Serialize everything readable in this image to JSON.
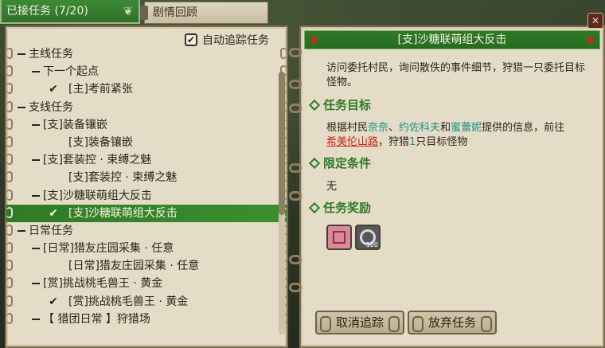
{
  "tabs": {
    "accepted": "已接任务 (7/20)",
    "story": "剧情回顾"
  },
  "auto_track_label": "自动追踪任务",
  "quest_list": [
    {
      "level": 0,
      "type": "dash",
      "text": "主线任务",
      "selected": false
    },
    {
      "level": 1,
      "type": "dash",
      "text": "下一个起点",
      "selected": false
    },
    {
      "level": 2,
      "type": "check",
      "text": "[主]考前紧张",
      "selected": false
    },
    {
      "level": 0,
      "type": "dash",
      "text": "支线任务",
      "selected": false
    },
    {
      "level": 1,
      "type": "dash",
      "text": "[支]装备镶嵌",
      "selected": false
    },
    {
      "level": 2,
      "type": "none",
      "text": "[支]装备镶嵌",
      "selected": false
    },
    {
      "level": 1,
      "type": "dash",
      "text": "[支]套装控 · 束缚之魅",
      "selected": false
    },
    {
      "level": 2,
      "type": "none",
      "text": "[支]套装控 · 束缚之魅",
      "selected": false
    },
    {
      "level": 1,
      "type": "dash",
      "text": "[支]沙糖联萌组大反击",
      "selected": false
    },
    {
      "level": 2,
      "type": "check",
      "text": "[支]沙糖联萌组大反击",
      "selected": true
    },
    {
      "level": 0,
      "type": "dash",
      "text": "日常任务",
      "selected": false
    },
    {
      "level": 1,
      "type": "dash",
      "text": "[日常]猎友庄园采集 · 任意",
      "selected": false
    },
    {
      "level": 2,
      "type": "none",
      "text": "[日常]猎友庄园采集 · 任意",
      "selected": false
    },
    {
      "level": 1,
      "type": "dash",
      "text": "[赏]挑战桃毛兽王 · 黄金",
      "selected": false
    },
    {
      "level": 2,
      "type": "check",
      "text": "[赏]挑战桃毛兽王 · 黄金",
      "selected": false
    },
    {
      "level": 1,
      "type": "dash",
      "text": "【 猎团日常 】狩猎场",
      "selected": false
    }
  ],
  "detail": {
    "title": "[支]沙糖联萌组大反击",
    "description": "访问委托村民，询问散佚的事件细节，狩猎一只委托目标怪物。",
    "objective_title": "任务目标",
    "objective": {
      "prefix": "根据村民",
      "npc1": "奈奈",
      "sep1": "、",
      "npc2": "约佐科夫",
      "sep2": "和",
      "npc3": "蜜蕾妮",
      "mid": "提供的信息，前往",
      "location": "希美伦山路",
      "mid2": "，狩猎",
      "count": "1",
      "suffix": "只目标怪物"
    },
    "condition_title": "限定条件",
    "condition": "无",
    "reward_title": "任务奖励",
    "reward_badge": "100"
  },
  "buttons": {
    "untrack": "取消追踪",
    "abandon": "放弃任务"
  },
  "icons": {
    "close": "close-icon",
    "check": "✔"
  }
}
